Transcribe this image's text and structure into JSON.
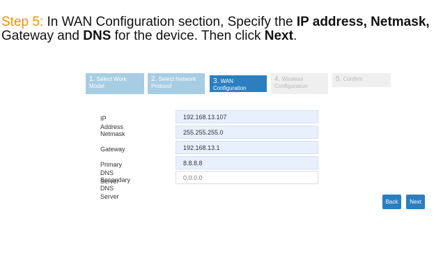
{
  "instruction": {
    "step": "Step 5:",
    "part1": " In WAN Configuration section, Specify the ",
    "b1": "IP address, Netmask,",
    "line2a": "Gateway and ",
    "b2": "DNS",
    "line2b": " for the device. Then click ",
    "b3": "Next",
    "line2c": "."
  },
  "wizard": {
    "steps": [
      {
        "num": "1.",
        "label": "Select Work Model",
        "state": "done"
      },
      {
        "num": "2.",
        "label": "Select Network Protocol",
        "state": "done"
      },
      {
        "num": "3.",
        "label": "WAN Configuration",
        "state": "active"
      },
      {
        "num": "4.",
        "label": "Wireless Configuration",
        "state": "todo"
      },
      {
        "num": "5.",
        "label": "Confirm",
        "state": "todo"
      }
    ]
  },
  "form": {
    "ip_label": "IP Address",
    "ip_value": "192.168.13.107",
    "netmask_label": "Netmask",
    "netmask_value": "255.255.255.0",
    "gateway_label": "Gateway",
    "gateway_value": "192.168.13.1",
    "dns1_label": "Primary DNS Server",
    "dns1_value": "8.8.8.8",
    "dns2_label": "Secondary DNS Server",
    "dns2_placeholder": "0.0.0.0"
  },
  "buttons": {
    "back": "Back",
    "next": "Next"
  },
  "colors": {
    "accent": "#2b7fc0",
    "step_done": "#a6cde4",
    "step_todo": "#efefef",
    "instruction_step": "#f29100"
  }
}
